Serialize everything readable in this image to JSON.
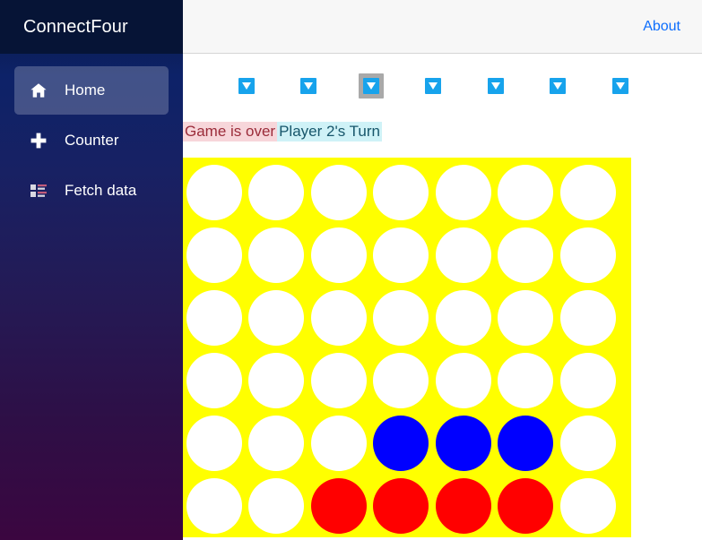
{
  "app": {
    "brand": "ConnectFour"
  },
  "topbar": {
    "about_label": "About"
  },
  "sidebar": {
    "items": [
      {
        "label": "Home",
        "icon": "home-icon",
        "active": true
      },
      {
        "label": "Counter",
        "icon": "plus-icon",
        "active": false
      },
      {
        "label": "Fetch data",
        "icon": "list-icon",
        "active": false
      }
    ]
  },
  "game": {
    "status_game_over": "Game is over",
    "status_turn": "Player 2's Turn",
    "columns": 7,
    "rows": 6,
    "hovered_column": 2,
    "drop_icon": "chevron-down-icon",
    "colors": {
      "board": "#ffff00",
      "empty": "#ffffff",
      "player1": "#ff0000",
      "player2": "#0000ff",
      "drop_button": "#17a3ec",
      "hover_highlight": "#a9a9a9"
    },
    "board_cells": [
      [
        "empty",
        "empty",
        "empty",
        "empty",
        "empty",
        "empty",
        "empty"
      ],
      [
        "empty",
        "empty",
        "empty",
        "empty",
        "empty",
        "empty",
        "empty"
      ],
      [
        "empty",
        "empty",
        "empty",
        "empty",
        "empty",
        "empty",
        "empty"
      ],
      [
        "empty",
        "empty",
        "empty",
        "empty",
        "empty",
        "empty",
        "empty"
      ],
      [
        "empty",
        "empty",
        "empty",
        "blue",
        "blue",
        "blue",
        "empty"
      ],
      [
        "empty",
        "empty",
        "red",
        "red",
        "red",
        "red",
        "empty"
      ]
    ]
  }
}
